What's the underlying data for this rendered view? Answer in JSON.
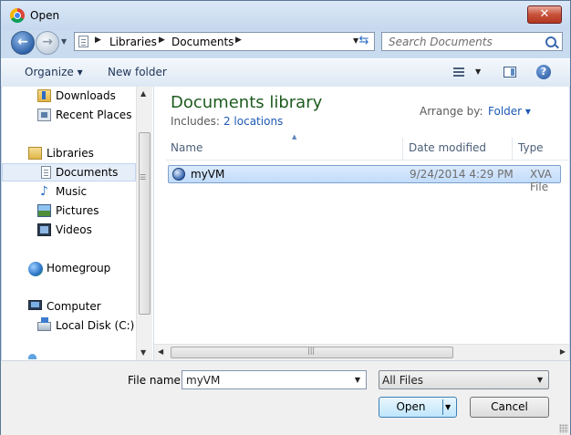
{
  "window": {
    "title": "Open",
    "close_label": "✕"
  },
  "navigation": {
    "back_glyph": "←",
    "forward_glyph": "→",
    "breadcrumbs": [
      "Libraries",
      "Documents"
    ],
    "search_placeholder": "Search Documents"
  },
  "toolbar": {
    "organize_label": "Organize ▾",
    "new_folder_label": "New folder",
    "help_glyph": "?"
  },
  "sidebar": {
    "items": [
      {
        "label": "Downloads",
        "icon": "downloads-folder-icon"
      },
      {
        "label": "Recent Places",
        "icon": "recent-places-icon"
      },
      {
        "label": "Libraries",
        "icon": "libraries-icon"
      },
      {
        "label": "Documents",
        "icon": "documents-icon",
        "selected": true
      },
      {
        "label": "Music",
        "icon": "music-icon"
      },
      {
        "label": "Pictures",
        "icon": "pictures-icon"
      },
      {
        "label": "Videos",
        "icon": "videos-icon"
      },
      {
        "label": "Homegroup",
        "icon": "homegroup-icon"
      },
      {
        "label": "Computer",
        "icon": "computer-icon"
      },
      {
        "label": "Local Disk (C:)",
        "icon": "local-disk-icon"
      }
    ]
  },
  "library": {
    "title": "Documents library",
    "includes_label": "Includes:",
    "includes_link": "2 locations",
    "arrange_label": "Arrange by:",
    "arrange_value": "Folder ▾"
  },
  "columns": [
    "Name",
    "Date modified",
    "Type"
  ],
  "files": [
    {
      "name": "myVM",
      "date_modified": "9/24/2014 4:29 PM",
      "type": "XVA File",
      "icon": "xva-file-icon",
      "selected": true
    }
  ],
  "footer": {
    "file_name_label": "File name:",
    "file_name_value": "myVM",
    "file_type_value": "All Files",
    "open_label": "Open",
    "cancel_label": "Cancel"
  }
}
